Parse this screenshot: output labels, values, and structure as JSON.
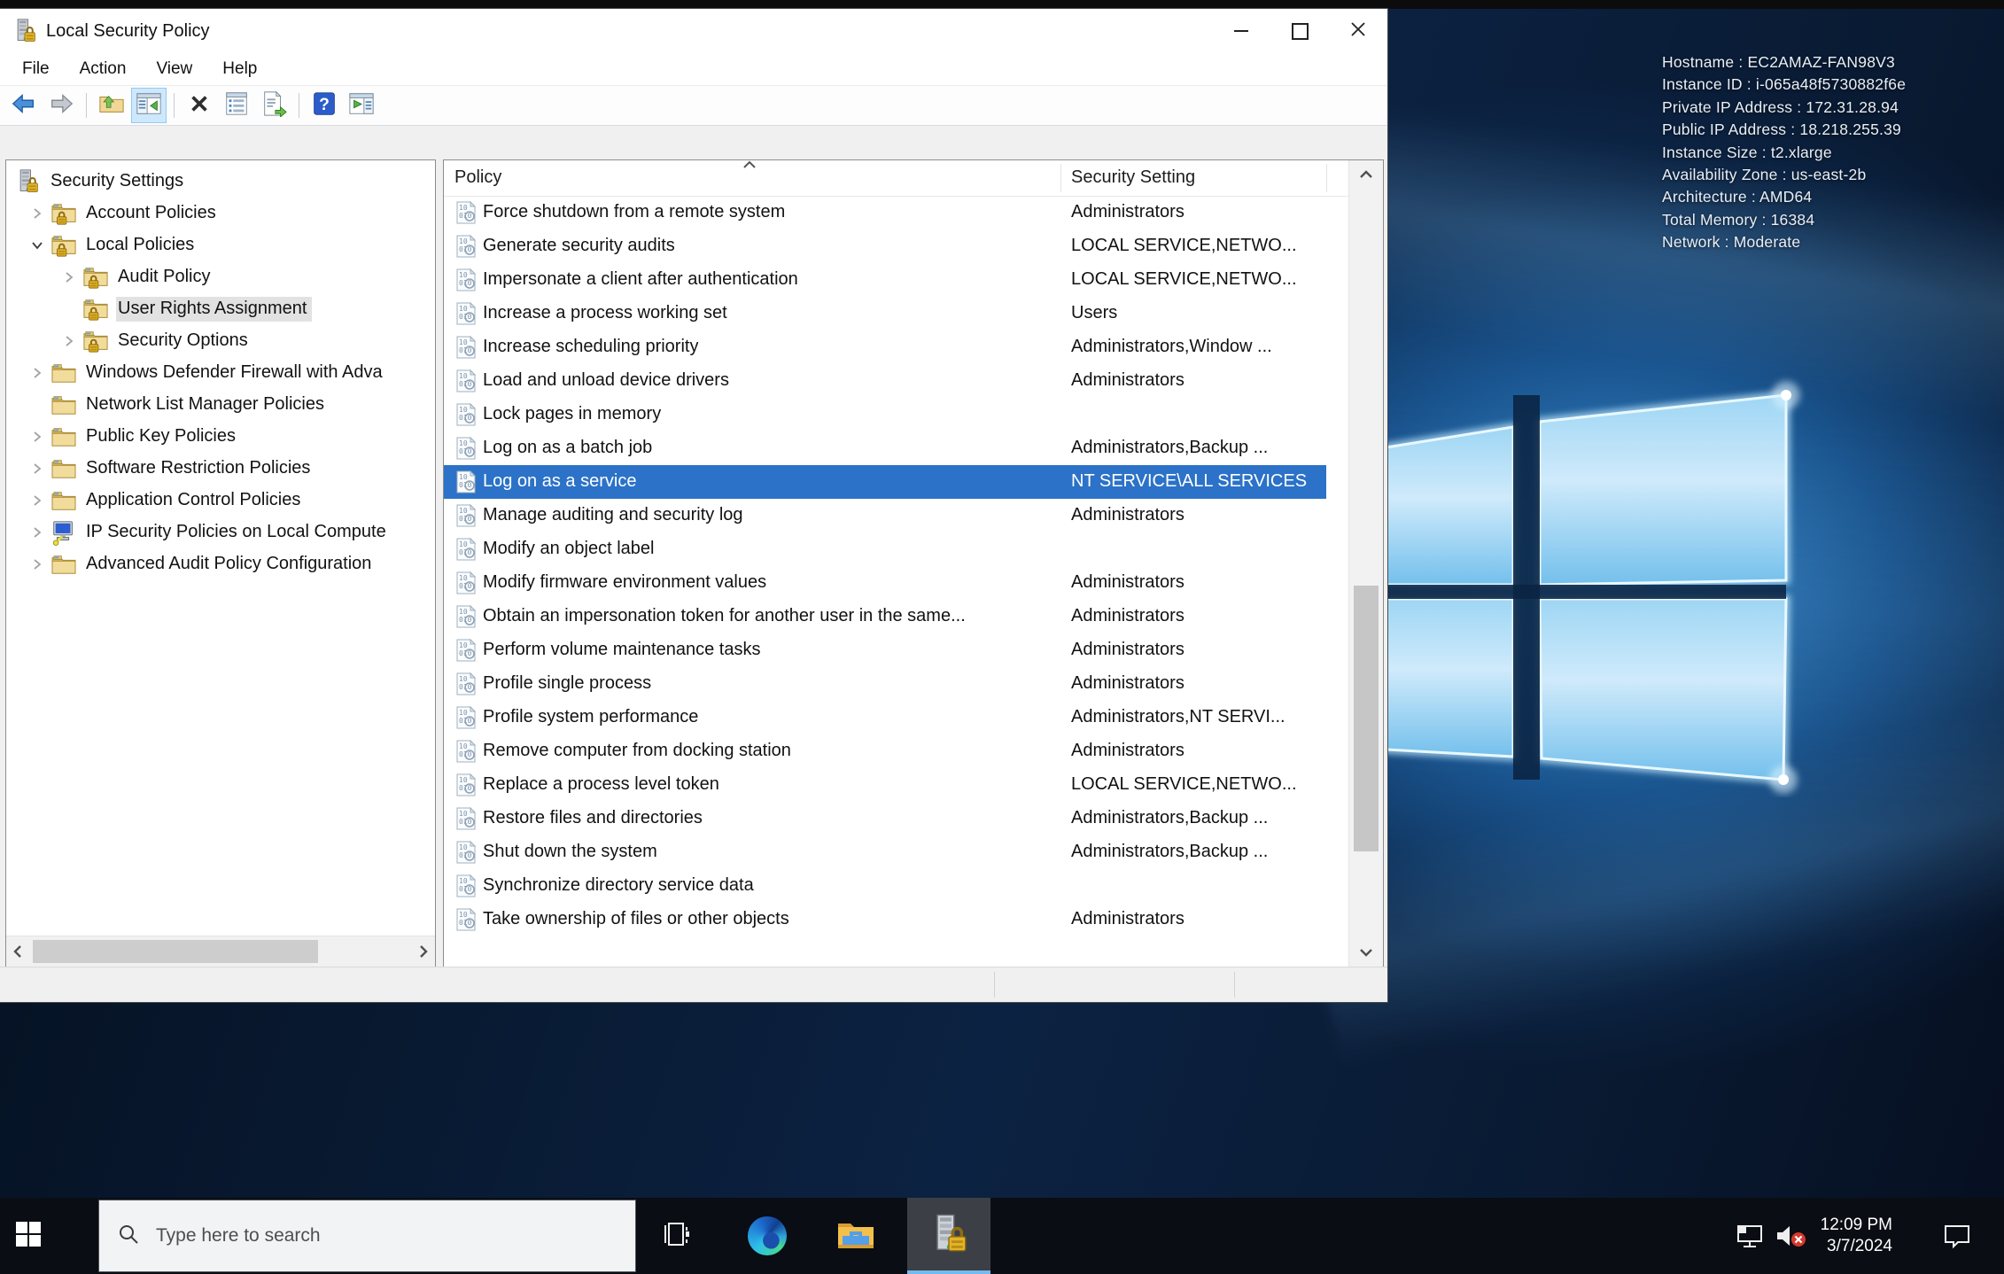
{
  "window": {
    "title": "Local Security Policy",
    "title_icon": "server-lock-icon",
    "controls": [
      "minimize",
      "maximize",
      "close"
    ],
    "menu": [
      "File",
      "Action",
      "View",
      "Help"
    ],
    "toolbar": [
      {
        "icon": "back"
      },
      {
        "icon": "forward"
      },
      {
        "icon": "sep"
      },
      {
        "icon": "up-folder"
      },
      {
        "icon": "console-tree",
        "active": true
      },
      {
        "icon": "sep"
      },
      {
        "icon": "delete"
      },
      {
        "icon": "properties"
      },
      {
        "icon": "export-list"
      },
      {
        "icon": "sep"
      },
      {
        "icon": "help"
      },
      {
        "icon": "action-pane"
      }
    ]
  },
  "tree": {
    "items": [
      {
        "label": "Security Settings",
        "depth": 0,
        "expander": "none",
        "icon": "server-lock",
        "selected": false
      },
      {
        "label": "Account Policies",
        "depth": 1,
        "expander": "collapsed",
        "icon": "folder-lock",
        "selected": false
      },
      {
        "label": "Local Policies",
        "depth": 1,
        "expander": "expanded",
        "icon": "folder-lock",
        "selected": false
      },
      {
        "label": "Audit Policy",
        "depth": 2,
        "expander": "collapsed",
        "icon": "folder-lock",
        "selected": false
      },
      {
        "label": "User Rights Assignment",
        "depth": 2,
        "expander": "none",
        "icon": "folder-lock",
        "selected": true
      },
      {
        "label": "Security Options",
        "depth": 2,
        "expander": "collapsed",
        "icon": "folder-lock",
        "selected": false
      },
      {
        "label": "Windows Defender Firewall with Adva",
        "depth": 1,
        "expander": "collapsed",
        "icon": "folder",
        "selected": false
      },
      {
        "label": "Network List Manager Policies",
        "depth": 1,
        "expander": "none",
        "icon": "folder",
        "selected": false
      },
      {
        "label": "Public Key Policies",
        "depth": 1,
        "expander": "collapsed",
        "icon": "folder",
        "selected": false
      },
      {
        "label": "Software Restriction Policies",
        "depth": 1,
        "expander": "collapsed",
        "icon": "folder",
        "selected": false
      },
      {
        "label": "Application Control Policies",
        "depth": 1,
        "expander": "collapsed",
        "icon": "folder",
        "selected": false
      },
      {
        "label": "IP Security Policies on Local Compute",
        "depth": 1,
        "expander": "collapsed",
        "icon": "ipsec",
        "selected": false
      },
      {
        "label": "Advanced Audit Policy Configuration",
        "depth": 1,
        "expander": "collapsed",
        "icon": "folder",
        "selected": false
      }
    ]
  },
  "list": {
    "columns": [
      "Policy",
      "Security Setting"
    ],
    "sort_indicator": "ascending",
    "rows": [
      {
        "policy": "Force shutdown from a remote system",
        "setting": "Administrators",
        "selected": false
      },
      {
        "policy": "Generate security audits",
        "setting": "LOCAL SERVICE,NETWO...",
        "selected": false
      },
      {
        "policy": "Impersonate a client after authentication",
        "setting": "LOCAL SERVICE,NETWO...",
        "selected": false
      },
      {
        "policy": "Increase a process working set",
        "setting": "Users",
        "selected": false
      },
      {
        "policy": "Increase scheduling priority",
        "setting": "Administrators,Window ...",
        "selected": false
      },
      {
        "policy": "Load and unload device drivers",
        "setting": "Administrators",
        "selected": false
      },
      {
        "policy": "Lock pages in memory",
        "setting": "",
        "selected": false
      },
      {
        "policy": "Log on as a batch job",
        "setting": "Administrators,Backup ...",
        "selected": false
      },
      {
        "policy": "Log on as a service",
        "setting": "NT SERVICE\\ALL SERVICES",
        "selected": true
      },
      {
        "policy": "Manage auditing and security log",
        "setting": "Administrators",
        "selected": false
      },
      {
        "policy": "Modify an object label",
        "setting": "",
        "selected": false
      },
      {
        "policy": "Modify firmware environment values",
        "setting": "Administrators",
        "selected": false
      },
      {
        "policy": "Obtain an impersonation token for another user in the same...",
        "setting": "Administrators",
        "selected": false
      },
      {
        "policy": "Perform volume maintenance tasks",
        "setting": "Administrators",
        "selected": false
      },
      {
        "policy": "Profile single process",
        "setting": "Administrators",
        "selected": false
      },
      {
        "policy": "Profile system performance",
        "setting": "Administrators,NT SERVI...",
        "selected": false
      },
      {
        "policy": "Remove computer from docking station",
        "setting": "Administrators",
        "selected": false
      },
      {
        "policy": "Replace a process level token",
        "setting": "LOCAL SERVICE,NETWO...",
        "selected": false
      },
      {
        "policy": "Restore files and directories",
        "setting": "Administrators,Backup ...",
        "selected": false
      },
      {
        "policy": "Shut down the system",
        "setting": "Administrators,Backup ...",
        "selected": false
      },
      {
        "policy": "Synchronize directory service data",
        "setting": "",
        "selected": false
      },
      {
        "policy": "Take ownership of files or other objects",
        "setting": "Administrators",
        "selected": false
      }
    ]
  },
  "desktop": {
    "instance_info": [
      "Hostname : EC2AMAZ-FAN98V3",
      "Instance ID : i-065a48f5730882f6e",
      "Private IP Address : 172.31.28.94",
      "Public IP Address : 18.218.255.39",
      "Instance Size : t2.xlarge",
      "Availability Zone : us-east-2b",
      "Architecture : AMD64",
      "Total Memory : 16384",
      "Network : Moderate"
    ]
  },
  "taskbar": {
    "search_placeholder": "Type here to search",
    "pinned_icons": [
      "start",
      "task-view",
      "edge",
      "file-explorer",
      "local-security-policy"
    ],
    "active_app": "local-security-policy",
    "tray_icons": [
      "network",
      "volume-muted",
      "action-center"
    ],
    "clock_time": "12:09 PM",
    "clock_date": "3/7/2024"
  },
  "colors": {
    "list_selection": "#2b72c8",
    "tree_selection": "#e2e2e2",
    "taskbar_bg": "#0a0d13",
    "active_app_underline": "#76b9ed",
    "window_bg": "#ffffff",
    "content_bg": "#f0f0f0",
    "wallpaper_dark": "#081930",
    "wallpaper_glow": "#3e96d8"
  }
}
